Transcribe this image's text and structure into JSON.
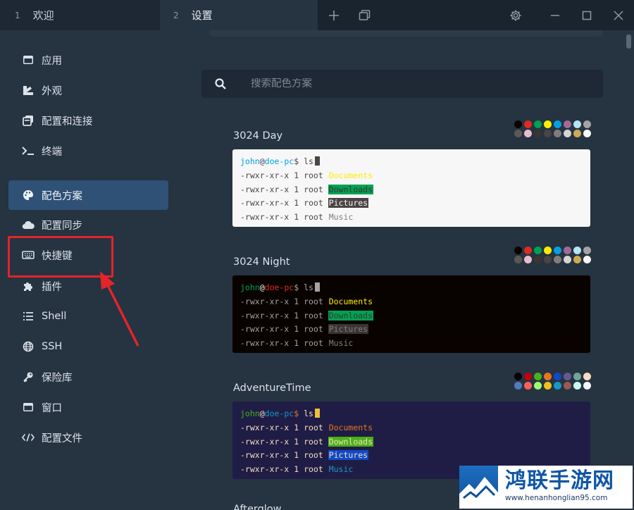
{
  "tabs": [
    {
      "number": "1",
      "label": "欢迎"
    },
    {
      "number": "2",
      "label": "设置"
    }
  ],
  "sidebar": {
    "items": [
      {
        "label": "应用",
        "icon": "app-window-icon"
      },
      {
        "label": "外观",
        "icon": "palette-brush-icon"
      },
      {
        "label": "配置和连接",
        "icon": "profiles-icon"
      },
      {
        "label": "终端",
        "icon": "terminal-prompt-icon"
      },
      {
        "label": "配色方案",
        "icon": "color-palette-icon"
      },
      {
        "label": "配置同步",
        "icon": "cloud-icon"
      },
      {
        "label": "快捷键",
        "icon": "keyboard-icon"
      },
      {
        "label": "插件",
        "icon": "puzzle-icon"
      },
      {
        "label": "Shell",
        "icon": "list-icon"
      },
      {
        "label": "SSH",
        "icon": "globe-icon"
      },
      {
        "label": "保险库",
        "icon": "key-icon"
      },
      {
        "label": "窗口",
        "icon": "window-icon"
      },
      {
        "label": "配置文件",
        "icon": "code-icon"
      }
    ],
    "active_index": 4
  },
  "search": {
    "placeholder": "搜索配色方案"
  },
  "schemes": [
    {
      "name": "3024 Day",
      "bg": "#f7f7f7",
      "fg": "#4a4543",
      "cursor": "#4a4543",
      "user": "#01a0e4",
      "at": "#4a4543",
      "host": "#01a0e4",
      "dollar": "#4a4543",
      "palette_top": [
        "#090300",
        "#db2d20",
        "#01a252",
        "#fded02",
        "#01a0e4",
        "#a16a94",
        "#b5e4f4",
        "#a5a2a2"
      ],
      "palette_bottom": [
        "#5c5855",
        "#e8bbd0",
        "#3a3432",
        "#4a4543",
        "#807d7c",
        "#d6d5d4",
        "#cdab53",
        "#f7f7f7"
      ],
      "lines": [
        {
          "perm": "-rwxr-xr-x",
          "n": "1",
          "owner": "root",
          "name": "Documents",
          "color": "#fded02",
          "bg": ""
        },
        {
          "perm": "-rwxr-xr-x",
          "n": "1",
          "owner": "root",
          "name": "Downloads",
          "color": "#3a3432",
          "bg": "#01a252"
        },
        {
          "perm": "-rwxr-xr-x",
          "n": "1",
          "owner": "root",
          "name": "Pictures",
          "color": "#f7f7f7",
          "bg": "#4a4543"
        },
        {
          "perm": "-rwxr-xr-x",
          "n": "1",
          "owner": "root",
          "name": "Music",
          "color": "#807d7c",
          "bg": ""
        }
      ]
    },
    {
      "name": "3024 Night",
      "bg": "#090300",
      "fg": "#a5a2a2",
      "cursor": "#a5a2a2",
      "user": "#01a252",
      "at": "#f7f7f7",
      "host": "#db2d20",
      "dollar": "#a5a2a2",
      "palette_top": [
        "#090300",
        "#db2d20",
        "#01a252",
        "#fded02",
        "#01a0e4",
        "#a16a94",
        "#b5e4f4",
        "#a5a2a2"
      ],
      "palette_bottom": [
        "#5c5855",
        "#e8bbd0",
        "#3a3432",
        "#4a4543",
        "#807d7c",
        "#d6d5d4",
        "#cdab53",
        "#f7f7f7"
      ],
      "lines": [
        {
          "perm": "-rwxr-xr-x",
          "n": "1",
          "owner": "root",
          "name": "Documents",
          "color": "#fded02",
          "bg": ""
        },
        {
          "perm": "-rwxr-xr-x",
          "n": "1",
          "owner": "root",
          "name": "Downloads",
          "color": "#3a3432",
          "bg": "#01a252"
        },
        {
          "perm": "-rwxr-xr-x",
          "n": "1",
          "owner": "root",
          "name": "Pictures",
          "color": "#807d7c",
          "bg": "#3a3432"
        },
        {
          "perm": "-rwxr-xr-x",
          "n": "1",
          "owner": "root",
          "name": "Music",
          "color": "#807d7c",
          "bg": ""
        }
      ]
    },
    {
      "name": "AdventureTime",
      "bg": "#1f1d45",
      "fg": "#f8dcc0",
      "cursor": "#efbf38",
      "user": "#4ab118",
      "at": "#f8dcc0",
      "host": "#1997c6",
      "dollar": "#e7741e",
      "palette_top": [
        "#050404",
        "#bd0013",
        "#4ab118",
        "#e7741e",
        "#0f4ac6",
        "#665993",
        "#70a598",
        "#f8dcc0"
      ],
      "palette_bottom": [
        "#4e7cbf",
        "#fc5f5a",
        "#9eff6e",
        "#efc11a",
        "#1997c6",
        "#9b5953",
        "#c8faf4",
        "#f6f5fb"
      ],
      "lines": [
        {
          "perm": "-rwxr-xr-x",
          "n": "1",
          "owner": "root",
          "name": "Documents",
          "color": "#e7741e",
          "bg": ""
        },
        {
          "perm": "-rwxr-xr-x",
          "n": "1",
          "owner": "root",
          "name": "Downloads",
          "color": "#f8dcc0",
          "bg": "#4ab118"
        },
        {
          "perm": "-rwxr-xr-x",
          "n": "1",
          "owner": "root",
          "name": "Pictures",
          "color": "#f8dcc0",
          "bg": "#0f4ac6"
        },
        {
          "perm": "-rwxr-xr-x",
          "n": "1",
          "owner": "root",
          "name": "Music",
          "color": "#1997c6",
          "bg": ""
        }
      ]
    }
  ],
  "prompt": {
    "user": "john",
    "at": "@",
    "host": "doe-pc",
    "dollar": "$",
    "command": "ls"
  },
  "next_scheme_partial": "Afterglow",
  "watermark": {
    "title": "鸿联手游网",
    "url": "www.henanhonglian95.com"
  },
  "colors": {
    "accent": "#2f5176",
    "annotation_red": "#e4242a"
  }
}
